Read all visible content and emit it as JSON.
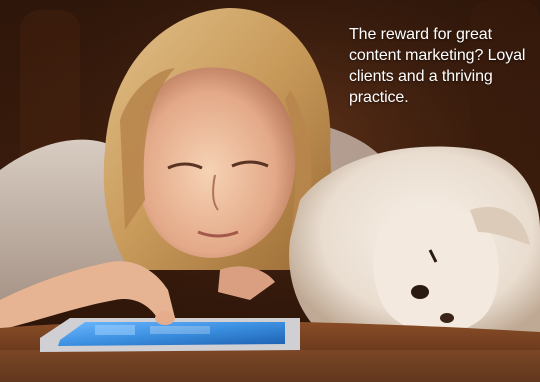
{
  "caption": {
    "text": "The reward for great content marketing? Loyal clients and a thriving practice."
  },
  "palette": {
    "background_dark": "#2a1409",
    "table_wood": "#6b3a1e",
    "tablet_screen": "#3b8fe0",
    "dog_fur": "#e9ddd0",
    "hair_blonde": "#c89a5a",
    "sweater": "#cfc2b8",
    "caption_text": "#ffffff"
  },
  "scene": {
    "subjects": [
      "young-woman",
      "tablet",
      "white-dog"
    ]
  }
}
